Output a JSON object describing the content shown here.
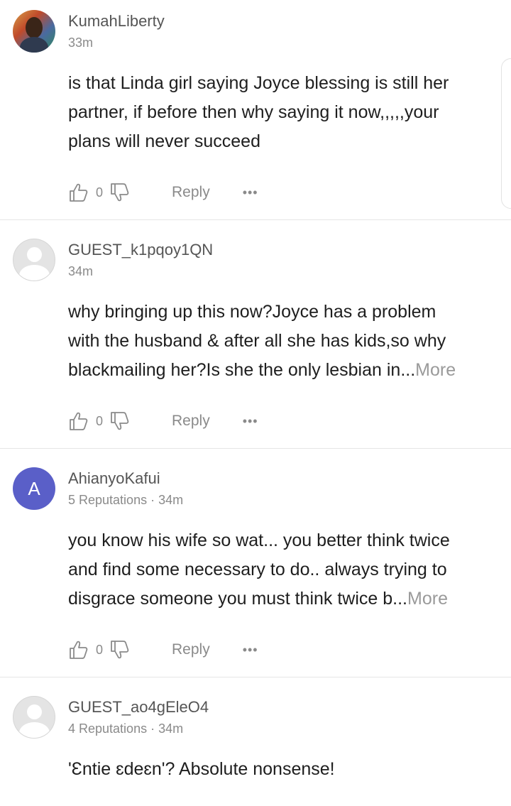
{
  "comments": [
    {
      "username": "KumahLiberty",
      "meta": "33m",
      "body": "is that Linda girl saying Joyce blessing is still her\npartner, if before then why saying it now,,,,,your\nplans will never succeed",
      "more": "",
      "likes": "0",
      "reply_label": "Reply",
      "more_icon": "•••"
    },
    {
      "username": "GUEST_k1pqoy1QN",
      "meta": "34m",
      "body": "why bringing up this now?Joyce has a problem\nwith the husband & after all she has kids,so why\nblackmailing her?Is she the only lesbian in...",
      "more": "More",
      "likes": "0",
      "reply_label": "Reply",
      "more_icon": "•••"
    },
    {
      "username": "AhianyoKafui",
      "avatar_letter": "A",
      "meta": "5 Reputations · 34m",
      "body": "you know his wife so wat... you better think twice\nand find some necessary to do.. always trying to\ndisgrace someone you must think twice b...",
      "more": "More",
      "likes": "0",
      "reply_label": "Reply",
      "more_icon": "•••"
    },
    {
      "username": "GUEST_ao4gEleO4",
      "meta": "4 Reputations · 34m",
      "body": "'Ɛntie ɛdeɛn'? Absolute nonsense!"
    }
  ],
  "colors": {
    "text": "#1e1e1e",
    "muted": "#8a8a8a",
    "letter_avatar": "#5a5fc8",
    "divider": "#e6e6e6"
  },
  "icons": [
    "thumbs-up-icon",
    "thumbs-down-icon",
    "more-options-icon"
  ]
}
